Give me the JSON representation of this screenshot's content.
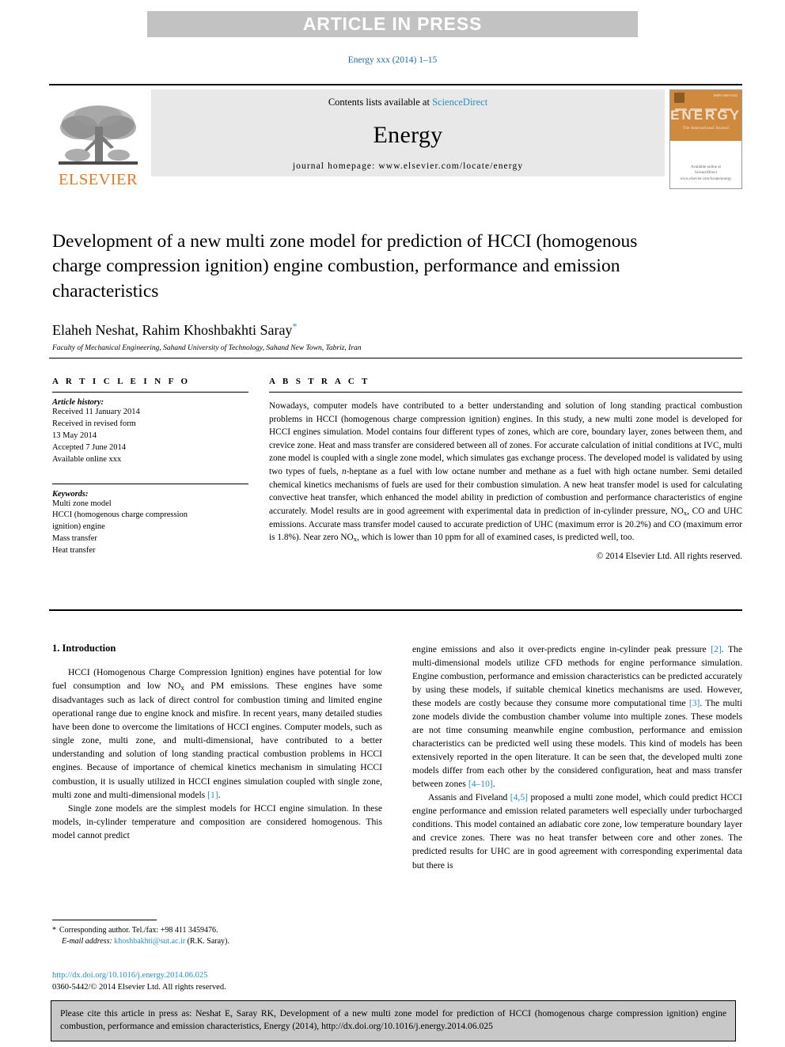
{
  "banner": {
    "text": "ARTICLE IN PRESS"
  },
  "running_head": "Energy xxx (2014) 1–15",
  "masthead": {
    "publisher_name": "ELSEVIER",
    "contents_prefix": "Contents lists available at ",
    "contents_link": "ScienceDirect",
    "journal_name": "Energy",
    "homepage": "journal homepage: www.elsevier.com/locate/energy",
    "cover": {
      "title": "ENERGY",
      "subtitle": "The International Journal",
      "issn": "ISSN 0360-5442",
      "footer_line1": "Available online at",
      "footer_line2": "ScienceDirect",
      "footer_line3": "www.elsevier.com/locate/energy"
    }
  },
  "article": {
    "title": "Development of a new multi zone model for prediction of HCCI (homogenous charge compression ignition) engine combustion, performance and emission characteristics",
    "authors": "Elaheh Neshat, Rahim Khoshbakhti Saray",
    "corresponding_marker": "*",
    "affiliation": "Faculty of Mechanical Engineering, Sahand University of Technology, Sahand New Town, Tabriz, Iran"
  },
  "article_info": {
    "heading": "A R T I C L E   I N F O",
    "history_label": "Article history:",
    "history": [
      "Received 11 January 2014",
      "Received in revised form",
      "13 May 2014",
      "Accepted 7 June 2014",
      "Available online xxx"
    ],
    "keywords_label": "Keywords:",
    "keywords": [
      "Multi zone model",
      "HCCI (homogenous charge compression",
      "ignition) engine",
      "Mass transfer",
      "Heat transfer"
    ]
  },
  "abstract": {
    "heading": "A B S T R A C T",
    "body_part1": "Nowadays, computer models have contributed to a better understanding and solution of long standing practical combustion problems in HCCI (homogenous charge compression ignition) engines. In this study, a new multi zone model is developed for HCCI engines simulation. Model contains four different types of zones, which are core, boundary layer, zones between them, and crevice zone. Heat and mass transfer are considered between all of zones. For accurate calculation of initial conditions at IVC, multi zone model is coupled with a single zone model, which simulates gas exchange process. The developed model is validated by using two types of fuels, ",
    "italic_fragment": "n",
    "body_part2": "-heptane as a fuel with low octane number and methane as a fuel with high octane number. Semi detailed chemical kinetics mechanisms of fuels are used for their combustion simulation. A new heat transfer model is used for calculating convective heat transfer, which enhanced the model ability in prediction of combustion and performance characteristics of engine accurately. Model results are in good agreement with experimental data in prediction of in-cylinder pressure, NO",
    "sub1": "x",
    "body_part3": ", CO and UHC emissions. Accurate mass transfer model caused to accurate prediction of UHC (maximum error is 20.2%) and CO (maximum error is 1.8%). Near zero NO",
    "sub2": "x",
    "body_part4": ", which is lower than 10 ppm for all of examined cases, is predicted well, too.",
    "copyright": "© 2014 Elsevier Ltd. All rights reserved."
  },
  "introduction": {
    "heading": "1. Introduction",
    "left_p1_a": "HCCI (Homogenous Charge Compression Ignition) engines have potential for low fuel consumption and low NO",
    "left_p1_sub": "x",
    "left_p1_b": " and PM emissions. These engines have some disadvantages such as lack of direct control for combustion timing and limited engine operational range due to engine knock and misfire. In recent years, many detailed studies have been done to overcome the limitations of HCCI engines. Computer models, such as single zone, multi zone, and multi-dimensional, have contributed to a better understanding and solution of long standing practical combustion problems in HCCI engines. Because of importance of chemical kinetics mechanism in simulating HCCI combustion, it is usually utilized in HCCI engines simulation coupled with single zone, multi zone and multi-dimensional models ",
    "left_p1_ref": "[1]",
    "left_p1_c": ".",
    "left_p2": "Single zone models are the simplest models for HCCI engine simulation. In these models, in-cylinder temperature and composition are considered homogenous. This model cannot predict",
    "right_p1_a": "engine emissions and also it over-predicts engine in-cylinder peak pressure ",
    "right_p1_ref1": "[2]",
    "right_p1_b": ". The multi-dimensional models utilize CFD methods for engine performance simulation. Engine combustion, performance and emission characteristics can be predicted accurately by using these models, if suitable chemical kinetics mechanisms are used. However, these models are costly because they consume more computational time ",
    "right_p1_ref2": "[3]",
    "right_p1_c": ". The multi zone models divide the combustion chamber volume into multiple zones. These models are not time consuming meanwhile engine combustion, performance and emission characteristics can be predicted well using these models. This kind of models has been extensively reported in the open literature. It can be seen that, the developed multi zone models differ from each other by the considered configuration, heat and mass transfer between zones ",
    "right_p1_ref3": "[4–10]",
    "right_p1_d": ".",
    "right_p2_a": "Assanis and Fiveland ",
    "right_p2_ref": "[4,5]",
    "right_p2_b": " proposed a multi zone model, which could predict HCCI engine performance and emission related parameters well especially under turbocharged conditions. This model contained an adiabatic core zone, low temperature boundary layer and crevice zones. There was no heat transfer between core and other zones. The predicted results for UHC are in good agreement with corresponding experimental data but there is"
  },
  "footnote": {
    "star": "*",
    "corresponding": "Corresponding author. Tel./fax: +98 411 3459476.",
    "email_label": "E-mail address:",
    "email": "khoshbakhti@sut.ac.ir",
    "email_owner": "(R.K. Saray)."
  },
  "doi_block": {
    "doi_url": "http://dx.doi.org/10.1016/j.energy.2014.06.025",
    "copyright_line": "0360-5442/© 2014 Elsevier Ltd. All rights reserved."
  },
  "citation_box": {
    "text": "Please cite this article in press as: Neshat E, Saray RK, Development of a new multi zone model for prediction of HCCI (homogenous charge compression ignition) engine combustion, performance and emission characteristics, Energy (2014), http://dx.doi.org/10.1016/j.energy.2014.06.025"
  },
  "colors": {
    "banner_gray": "#c2c2c2",
    "link_blue": "#2a8fc4",
    "elsevier_orange": "#e87722",
    "journal_box_gray": "#e8e8e8",
    "cite_box_gray": "#c8c8c8",
    "cover_orange": "#d08a3e"
  }
}
